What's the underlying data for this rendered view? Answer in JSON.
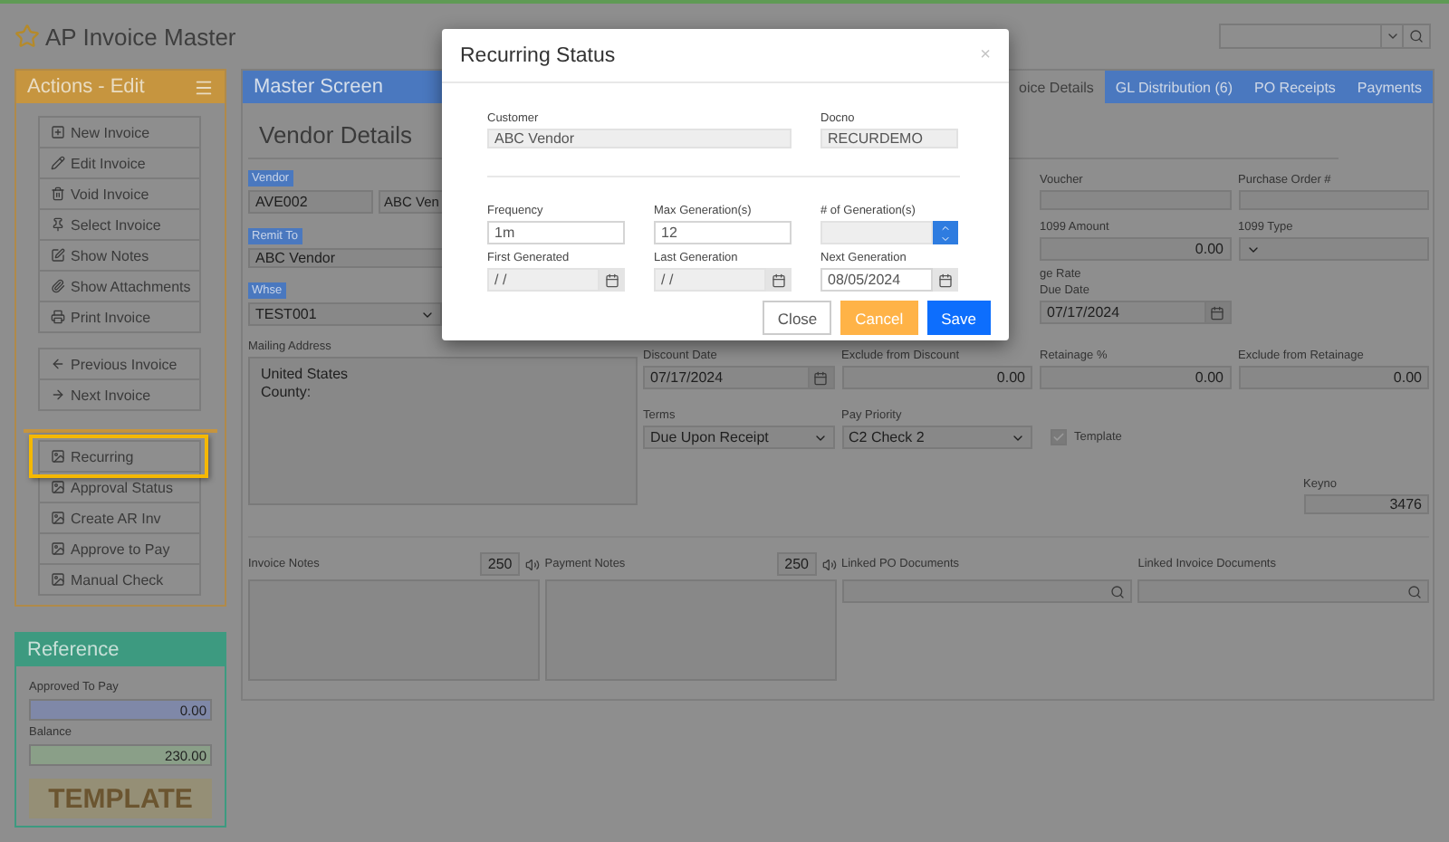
{
  "app": {
    "title": "AP Invoice Master"
  },
  "actions": {
    "title": "Actions - Edit",
    "groups": [
      [
        {
          "label": "New Invoice",
          "highlighted": false
        },
        {
          "label": "Edit Invoice",
          "highlighted": false
        },
        {
          "label": "Void Invoice",
          "highlighted": false
        },
        {
          "label": "Select Invoice",
          "highlighted": false
        },
        {
          "label": "Show Notes",
          "highlighted": false
        },
        {
          "label": "Show Attachments",
          "highlighted": false
        },
        {
          "label": "Print Invoice",
          "highlighted": false
        }
      ],
      [
        {
          "label": "Previous Invoice",
          "highlighted": false
        },
        {
          "label": "Next Invoice",
          "highlighted": false
        }
      ],
      [
        {
          "label": "Recurring",
          "highlighted": true
        },
        {
          "label": "Approval Status",
          "highlighted": false
        },
        {
          "label": "Create AR Inv",
          "highlighted": false
        },
        {
          "label": "Approve to Pay",
          "highlighted": false
        },
        {
          "label": "Manual Check",
          "highlighted": false
        }
      ]
    ]
  },
  "reference": {
    "title": "Reference",
    "fields": [
      {
        "label": "Approved To Pay",
        "value": "0.00",
        "color": "#7f88a8"
      },
      {
        "label": "Balance",
        "value": "230.00",
        "color": "#8a9f88"
      }
    ],
    "badge": "TEMPLATE"
  },
  "main": {
    "header": "Master Screen",
    "tabs": [
      {
        "label": "oice Details",
        "selected": true
      },
      {
        "label": "GL Distribution (6)",
        "selected": false
      },
      {
        "label": "PO Receipts",
        "selected": false
      },
      {
        "label": "Payments",
        "selected": false
      }
    ],
    "section_title": "Vendor Details",
    "vendor": {
      "label": "Vendor",
      "code": "AVE002",
      "name": "ABC Ven"
    },
    "remit_to": {
      "label": "Remit To",
      "value": "ABC Vendor"
    },
    "whse": {
      "label": "Whse",
      "value": "TEST001"
    },
    "mailing_address": {
      "label": "Mailing Address",
      "lines": [
        "United States",
        "County:"
      ]
    },
    "voucher": {
      "label": "Voucher"
    },
    "purchase_order": {
      "label": "Purchase Order #"
    },
    "amount_1099": {
      "label": "1099 Amount",
      "value": "0.00"
    },
    "type_1099": {
      "label": "1099 Type"
    },
    "exchange_rate": {
      "label": "ge Rate"
    },
    "due_date": {
      "label": "Due Date",
      "value": "07/17/2024"
    },
    "amounts": [
      {
        "label": "Discount Date",
        "value": "07/17/2024",
        "kind": "date"
      },
      {
        "label": "Exclude from Discount",
        "value": "0.00",
        "kind": "number"
      },
      {
        "label": "Retainage %",
        "value": "0.00",
        "kind": "number"
      },
      {
        "label": "Exclude from Retainage",
        "value": "0.00",
        "kind": "number"
      }
    ],
    "terms": {
      "label": "Terms",
      "value": "Due Upon Receipt"
    },
    "pay_priority": {
      "label": "Pay Priority",
      "value": "C2 Check 2"
    },
    "template": {
      "label": "Template",
      "checked": true
    },
    "keyno": {
      "label": "Keyno",
      "value": "3476"
    },
    "notes": [
      {
        "label": "Invoice Notes",
        "count": "250"
      },
      {
        "label": "Payment Notes",
        "count": "250"
      }
    ],
    "linked": [
      {
        "label": "Linked PO Documents"
      },
      {
        "label": "Linked Invoice Documents"
      }
    ]
  },
  "dialog": {
    "title": "Recurring Status",
    "close": "×",
    "customer": {
      "label": "Customer",
      "value": "ABC Vendor"
    },
    "docno": {
      "label": "Docno",
      "value": "RECURDEMO"
    },
    "fields": [
      {
        "label": "Frequency",
        "value": "1m",
        "kind": "text",
        "disabled": false
      },
      {
        "label": "Max Generation(s)",
        "value": "12",
        "kind": "text",
        "disabled": false
      },
      {
        "label": "# of Generation(s)",
        "kind": "spinner",
        "disabled": true
      },
      {
        "label": "First Generated",
        "value": "/ /",
        "kind": "date",
        "disabled": true
      },
      {
        "label": "Last Generation",
        "value": "/ /",
        "kind": "date",
        "disabled": true
      },
      {
        "label": "Next Generation",
        "value": "08/05/2024",
        "kind": "date",
        "disabled": false
      }
    ],
    "buttons": [
      {
        "label": "Close",
        "kind": "default"
      },
      {
        "label": "Cancel",
        "kind": "warning"
      },
      {
        "label": "Save",
        "kind": "primary"
      }
    ]
  }
}
